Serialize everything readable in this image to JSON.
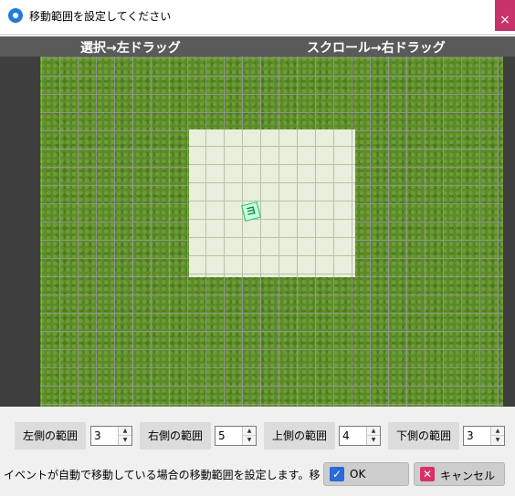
{
  "window": {
    "title": "移動範囲を設定してください",
    "app_icon": "settings-gear-icon",
    "close_symbol": "×",
    "close_color": "#c8326a"
  },
  "hints": {
    "left": "選択→左ドラッグ",
    "right": "スクロール→右ドラッグ"
  },
  "map": {
    "tile": "grass",
    "tile_color": "#5c8a2a",
    "region_color": "#e8efdc",
    "event_marker": {
      "glyph": "ヨ",
      "color": "#1bb76a"
    }
  },
  "range": {
    "left_label": "左側の範囲",
    "left_value": "3",
    "right_label": "右側の範囲",
    "right_value": "5",
    "top_label": "上側の範囲",
    "top_value": "4",
    "bottom_label": "下側の範囲",
    "bottom_value": "3"
  },
  "description": "イベントが自動で移動している場合の移動範囲を設定します。移動",
  "buttons": {
    "ok_label": "OK",
    "ok_icon": "checkmark-icon",
    "ok_icon_color": "#2a6ad8",
    "cancel_label": "キャンセル",
    "cancel_icon": "close-x-icon",
    "cancel_icon_color": "#d8306a"
  }
}
